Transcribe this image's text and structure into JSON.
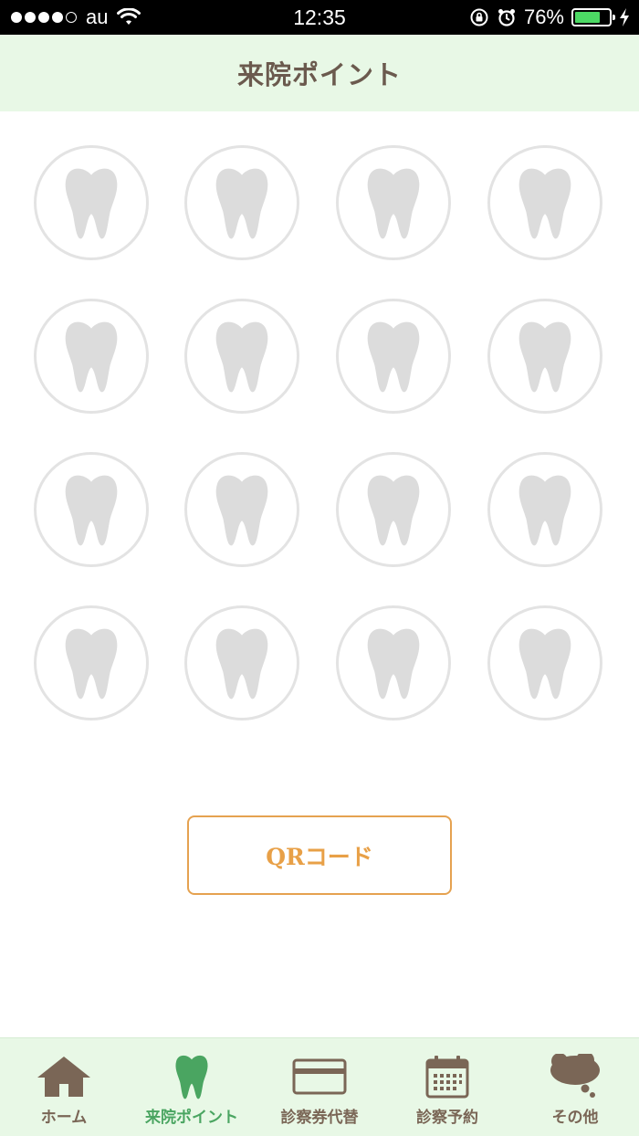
{
  "status_bar": {
    "carrier": "au",
    "time": "12:35",
    "battery_percent": 76,
    "battery_label": "76%",
    "signal_bars_filled": 4,
    "signal_bars_total": 5
  },
  "header": {
    "title": "来院ポイント"
  },
  "stamp_card": {
    "rows": 4,
    "columns": 4,
    "stamped_count": 0,
    "icon": "tooth-icon"
  },
  "qr_button": {
    "label": "QRコード"
  },
  "tabs": [
    {
      "label": "ホーム",
      "icon": "home-icon",
      "active": false
    },
    {
      "label": "来院ポイント",
      "icon": "tooth-icon",
      "active": true
    },
    {
      "label": "診察券代替",
      "icon": "card-icon",
      "active": false
    },
    {
      "label": "診察予約",
      "icon": "calendar-icon",
      "active": false
    },
    {
      "label": "その他",
      "icon": "speech-bubble-icon",
      "active": false
    }
  ],
  "colors": {
    "header_bg": "#e8f8e6",
    "title_text": "#6b5a4e",
    "stamp_border": "#e3e3e3",
    "stamp_icon": "#dcdcdc",
    "accent_orange": "#e8a047",
    "tab_active": "#4aa561",
    "tab_icon": "#7a6656",
    "battery_fill": "#4cd964"
  }
}
